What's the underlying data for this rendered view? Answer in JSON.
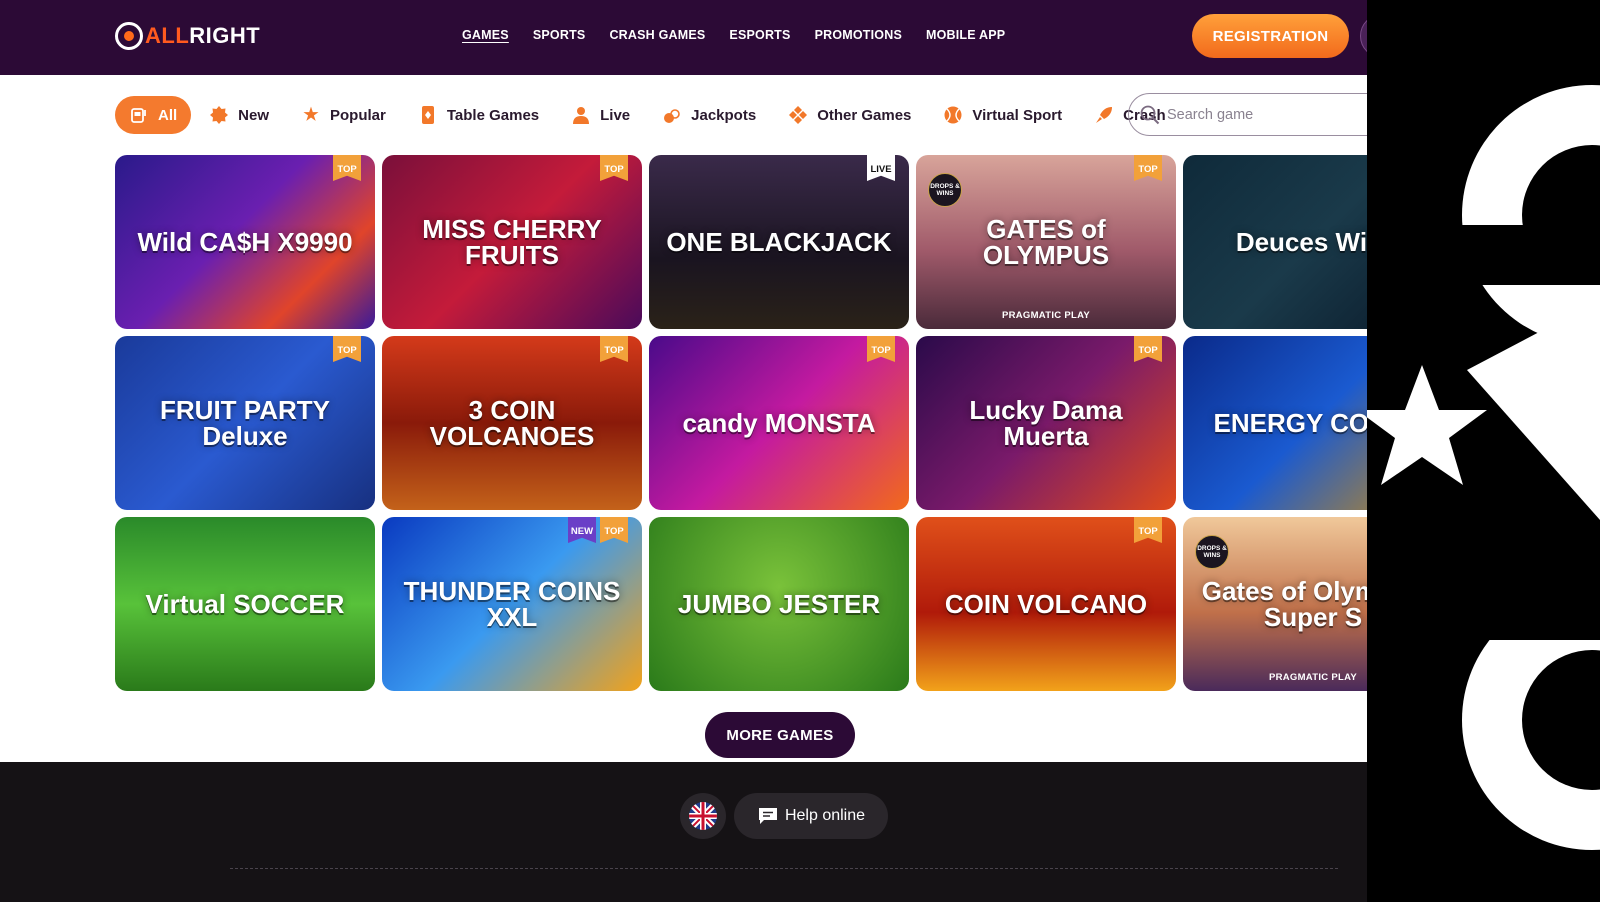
{
  "brand": {
    "part1": "ALL",
    "part2": "RIGHT"
  },
  "nav": [
    {
      "label": "GAMES",
      "active": true
    },
    {
      "label": "SPORTS"
    },
    {
      "label": "CRASH GAMES"
    },
    {
      "label": "ESPORTS"
    },
    {
      "label": "PROMOTIONS"
    },
    {
      "label": "MOBILE APP"
    }
  ],
  "registration_label": "REGISTRATION",
  "categories": [
    {
      "label": "All",
      "icon": "slot-machine-icon",
      "active": true
    },
    {
      "label": "New",
      "icon": "new-badge-icon"
    },
    {
      "label": "Popular",
      "icon": "star-icon"
    },
    {
      "label": "Table Games",
      "icon": "card-icon"
    },
    {
      "label": "Live",
      "icon": "person-icon"
    },
    {
      "label": "Jackpots",
      "icon": "jackpot-icon"
    },
    {
      "label": "Other Games",
      "icon": "diamonds-icon"
    },
    {
      "label": "Virtual Sport",
      "icon": "ball-icon"
    },
    {
      "label": "Crash",
      "icon": "rocket-icon"
    }
  ],
  "search": {
    "placeholder": "Search game"
  },
  "games": [
    {
      "title": "Wild CA$H X9990",
      "badges": [
        "TOP"
      ],
      "bg": "linear-gradient(135deg,#2a1a8a,#6a1fb0 45%,#e0442a 75%,#3a1a9a)"
    },
    {
      "title": "MISS CHERRY FRUITS",
      "badges": [
        "TOP"
      ],
      "bg": "linear-gradient(135deg,#7a0f3a,#c41b3a 50%,#4a0a5a)"
    },
    {
      "title": "ONE BLACKJACK",
      "badges": [
        "LIVE"
      ],
      "bg": "linear-gradient(180deg,#3a2a4a,#1a1420 60%,#2a2218)"
    },
    {
      "title": "GATES of OLYMPUS",
      "badges": [
        "TOP"
      ],
      "provider": "PRAGMATIC PLAY",
      "drops": "DROPS & WINS",
      "bg": "linear-gradient(180deg,#d8a49a,#a05a6a 55%,#4a2a3a)"
    },
    {
      "title": "Deuces Wild",
      "badges": [],
      "bg": "linear-gradient(135deg,#0f2a3a,#1a3a4a 50%,#0a1a2a)"
    },
    {
      "title": "FRUIT PARTY Deluxe",
      "badges": [
        "TOP"
      ],
      "bg": "linear-gradient(135deg,#1a3a9a,#2a5ad0 50%,#173080)"
    },
    {
      "title": "3 COIN VOLCANOES",
      "badges": [
        "TOP"
      ],
      "bg": "linear-gradient(180deg,#d43a1a,#8a1a0a 50%,#c4621a)"
    },
    {
      "title": "candy MONSTA",
      "badges": [
        "TOP"
      ],
      "bg": "linear-gradient(135deg,#4a0a8a,#c41aa0 50%,#f26a1a)"
    },
    {
      "title": "Lucky Dama Muerta",
      "badges": [
        "TOP"
      ],
      "bg": "linear-gradient(135deg,#2a0a4a,#7a1a6a 50%,#e04a1a)"
    },
    {
      "title": "ENERGY COINS",
      "badges": [],
      "bg": "linear-gradient(135deg,#0a2a8a,#1a5ad0 50%,#c48a1a)"
    },
    {
      "title": "Virtual SOCCER",
      "badges": [],
      "bg": "linear-gradient(180deg,#2a8a2a,#58c23a 50%,#2a7a1a)"
    },
    {
      "title": "THUNDER COINS XXL",
      "badges": [
        "NEW",
        "TOP"
      ],
      "bg": "linear-gradient(135deg,#0a3ac0,#3a9af0 50%,#f2a21a)"
    },
    {
      "title": "JUMBO JESTER",
      "badges": [],
      "bg": "radial-gradient(circle at 50% 40%,#7ac23a,#2a7a1a)"
    },
    {
      "title": "COIN VOLCANO",
      "badges": [
        "TOP"
      ],
      "bg": "linear-gradient(180deg,#e0501a,#b01a0a 55%,#f2a21a)"
    },
    {
      "title": "Gates of Olympus Super S",
      "badges": [],
      "provider": "PRAGMATIC PLAY",
      "drops": "DROPS & WINS",
      "bg": "linear-gradient(180deg,#f0c89a,#c0704a 55%,#4a2a5a)"
    }
  ],
  "more_games_label": "MORE GAMES",
  "help_label": "Help online",
  "colors": {
    "header": "#2c0a36",
    "accent": "#f47a2e",
    "footer": "#151215"
  }
}
